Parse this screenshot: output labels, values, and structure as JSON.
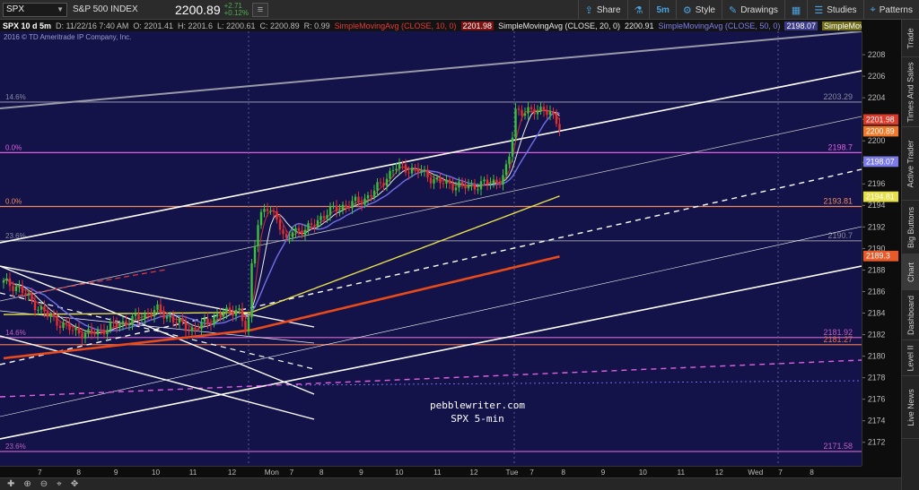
{
  "toolbar": {
    "symbol": "SPX",
    "symbol_name": "S&P 500 INDEX",
    "last_price": "2200.89",
    "change": "+2.71",
    "change_pct": "+0.12%",
    "buttons": [
      {
        "label": "Share",
        "icon": "share-icon"
      },
      {
        "label": "",
        "icon": "flask-icon"
      },
      {
        "label": "5m",
        "icon": "timeframe"
      },
      {
        "label": "Style",
        "icon": "style-icon"
      },
      {
        "label": "Drawings",
        "icon": "pencil-icon"
      },
      {
        "label": "",
        "icon": "layout-icon"
      },
      {
        "label": "Studies",
        "icon": "studies-icon"
      },
      {
        "label": "Patterns",
        "icon": "patterns-icon"
      }
    ]
  },
  "infobar": {
    "symbol": "SPX 10 d 5m",
    "date": "D: 11/22/16 7:40 AM",
    "open": "O: 2201.41",
    "high": "H: 2201.6",
    "low": "L: 2200.61",
    "close": "C: 2200.89",
    "r": "R: 0.99",
    "sma10_label": "SimpleMovingAvg (CLOSE, 10, 0)",
    "sma10_value": "2201.98",
    "sma20_label": "SimpleMovingAvg (CLOSE, 20, 0)",
    "sma20_value": "2200.91",
    "sma50_label": "SimpleMovingAvg (CLOSE, 50, 0)",
    "sma50_value": "2198.07",
    "smax_label": "SimpleMoving..."
  },
  "copyright": "2016 © TD Ameritrade IP Company, Inc.",
  "watermark": {
    "line1": "pebblewriter.com",
    "line2": "SPX 5-min"
  },
  "price_axis": {
    "ticks": [
      "2208",
      "2206",
      "2204",
      "2202",
      "2200",
      "2198",
      "2196",
      "2194",
      "2192",
      "2190",
      "2188",
      "2186",
      "2184",
      "2182",
      "2180",
      "2178",
      "2176",
      "2174",
      "2172"
    ],
    "badges": [
      {
        "label": "2201.98",
        "color": "#d93a2a",
        "price": 2201.98
      },
      {
        "label": "2200.89",
        "color": "#f07a2a",
        "price": 2200.89
      },
      {
        "label": "2198.07",
        "color": "#7a7ae8",
        "price": 2198.07
      },
      {
        "label": "2194.81",
        "color": "#e6e04a",
        "price": 2194.81
      },
      {
        "label": "2189.3",
        "color": "#e85a2a",
        "price": 2189.3
      }
    ]
  },
  "fib_levels": [
    {
      "pct": "14.6%",
      "value": "2203.29",
      "price": 2203.29,
      "color": "#8a8aa0"
    },
    {
      "pct": "0.0%",
      "value": "2198.7",
      "price": 2198.7,
      "color": "#e060e0"
    },
    {
      "pct": "0.0%",
      "value": "2193.81",
      "price": 2193.81,
      "color": "#f08a5a"
    },
    {
      "pct": "23.6%",
      "value": "2190.7",
      "price": 2190.7,
      "color": "#8a8aa0"
    },
    {
      "pct": "14.6%",
      "value": "2181.92",
      "price": 2181.92,
      "color": "#c060c0"
    },
    {
      "pct": "",
      "value": "2181.27",
      "price": 2181.27,
      "color": "#e07050"
    },
    {
      "pct": "23.6%",
      "value": "2171.58",
      "price": 2171.58,
      "color": "#c060c0"
    }
  ],
  "time_axis": [
    "7",
    "8",
    "9",
    "10",
    "11",
    "12",
    "Mon",
    "7",
    "8",
    "9",
    "10",
    "11",
    "12",
    "Tue",
    "7",
    "8",
    "9",
    "10",
    "11",
    "12",
    "Wed",
    "7",
    "8"
  ],
  "sidebar_tabs": [
    "Trade",
    "Times And Sales",
    "Active Trader",
    "Big Buttons",
    "Chart",
    "Dashboard",
    "Level II",
    "Live News"
  ],
  "colors": {
    "plot_bg": "#13134a",
    "sma10": "#d03030",
    "sma20": "#e8e8e8",
    "sma50": "#7070e8",
    "sma_yellow": "#e6e04a",
    "sma_orange": "#e84a1a",
    "up_candle": "#3cbf3c",
    "down_candle": "#e03030"
  }
}
